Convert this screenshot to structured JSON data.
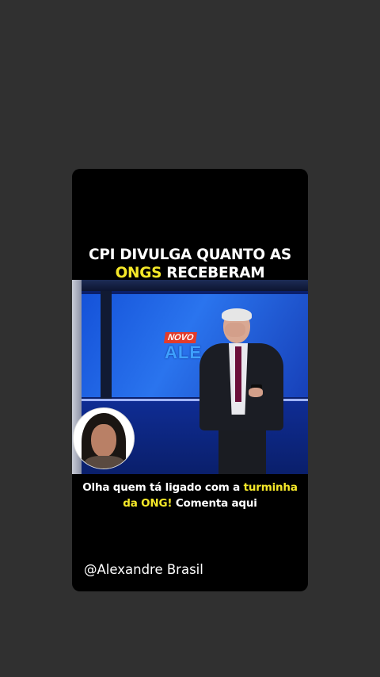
{
  "post": {
    "headline": {
      "line1": "CPI DIVULGA QUANTO AS",
      "highlight": "ONGS",
      "line2_rest": " RECEBERAM"
    },
    "video": {
      "logo_top": "NOVO",
      "logo_bottom": "ALE"
    },
    "caption": {
      "part1": "Olha quem tá ligado com a ",
      "highlight1": "turminha",
      "highlight2": "da ONG!",
      "part2": " Comenta aqui"
    },
    "handle": "@Alexandre Brasil"
  },
  "colors": {
    "background": "#303030",
    "card": "#000000",
    "highlight": "#f5e829",
    "studio_blue": "#1451d8"
  }
}
